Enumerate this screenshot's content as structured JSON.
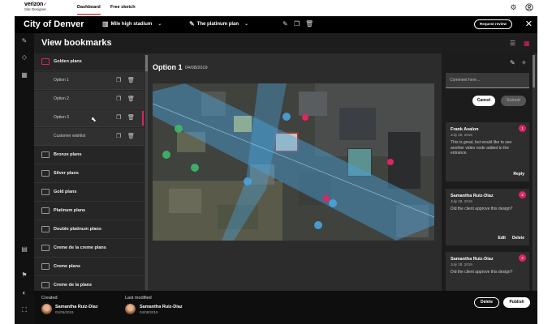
{
  "brand": {
    "name": "verizon",
    "check": "✓",
    "product": "Site Designer"
  },
  "nav": {
    "dashboard": "Dashboard",
    "free_sketch": "Free sketch"
  },
  "header": {
    "city": "City of Denver",
    "venue": "Mile high stadium",
    "plan": "The platinum plan",
    "request_review": "Request review"
  },
  "panel": {
    "title": "View bookmarks"
  },
  "bookmarks": {
    "golden": "Golden plans",
    "options": [
      "Option 1",
      "Option 2",
      "Option 3",
      "Customer wishlist"
    ],
    "folders": [
      "Bronze plans",
      "Silver plans",
      "Gold plans",
      "Platinum plans",
      "Double platinum plans",
      "Creme de la creme plans",
      "Creme plans",
      "Creme de la plans"
    ]
  },
  "option": {
    "title": "Option 1",
    "date": "04/08/2019"
  },
  "comments": {
    "placeholder": "Comment here...",
    "cancel": "Cancel",
    "submit": "Submit",
    "items": [
      {
        "badge": "1",
        "name": "Frank Avalon",
        "date": "July 28, 2019",
        "text": "This is great, but would like to see another video node added to the entrance.",
        "reply": "Reply"
      },
      {
        "badge": "2",
        "name": "Samantha Ruiz-Diaz",
        "date": "July 28, 2019",
        "text": "Did the client approve this design?",
        "edit": "Edit",
        "delete": "Delete"
      },
      {
        "badge": "3",
        "name": "Samantha Ruiz-Diaz",
        "date": "July 28, 2019",
        "text": "Did the client approve this design?"
      }
    ]
  },
  "footer": {
    "created_label": "Created",
    "created_name": "Samantha Ruiz-Diaz",
    "created_date": "01/05/2019",
    "modified_label": "Last modified",
    "modified_name": "Samantha Ruiz-Diaz",
    "modified_date": "04/08/2019",
    "delete": "Delete",
    "publish": "Publish"
  },
  "colors": {
    "accent": "#e0245e",
    "brand_red": "#cd040b",
    "node_blue": "#4ba3dd",
    "node_green": "#3fb86b"
  }
}
